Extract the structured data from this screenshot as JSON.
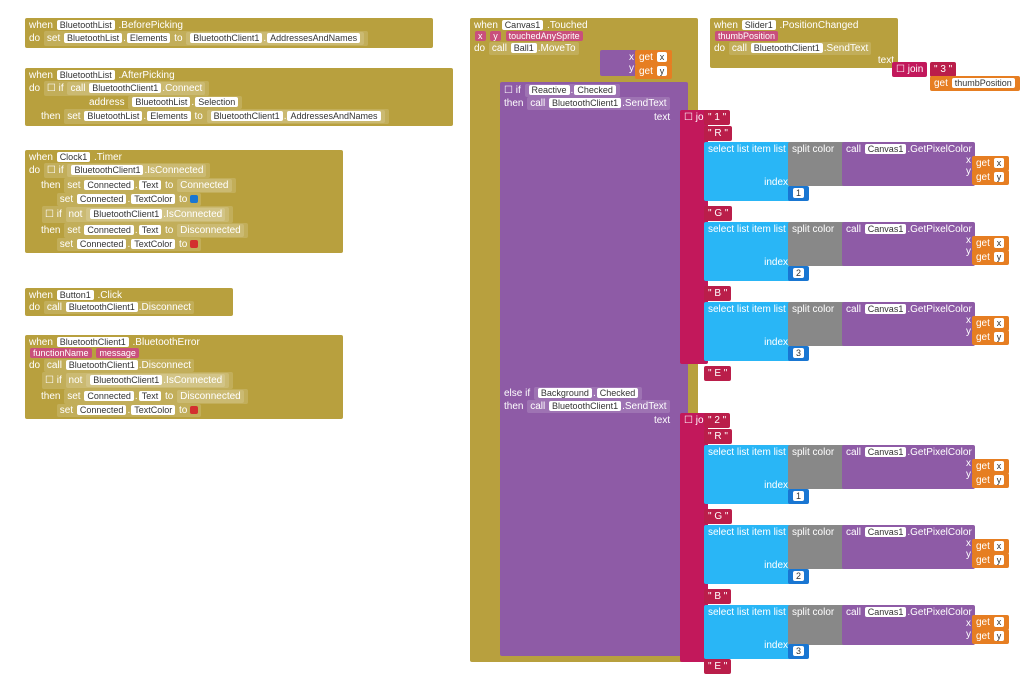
{
  "kw": {
    "when": "when",
    "do": "do",
    "set": "set",
    "call": "call",
    "if": "if",
    "then": "then",
    "elseif": "else if",
    "not": "not",
    "to": "to",
    "get": "get",
    "join": "join",
    "text": "text",
    "address": "address",
    "index": "index",
    "list": "list",
    "x": "x",
    "y": "y"
  },
  "comp": {
    "btlist": "BluetoothList",
    "btclient": "BluetoothClient1",
    "clock": "Clock1",
    "button": "Button1",
    "connected": "Connected",
    "canvas": "Canvas1",
    "ball": "Ball1",
    "slider": "Slider1",
    "reactive": "Reactive",
    "background": "Background"
  },
  "evt": {
    "beforepicking": "BeforePicking",
    "afterpicking": "AfterPicking",
    "timer": "Timer",
    "click": "Click",
    "bterror": "BluetoothError",
    "touched": "Touched",
    "poschanged": "PositionChanged"
  },
  "meth": {
    "connect": "Connect",
    "disconnect": "Disconnect",
    "isconnected": "IsConnected",
    "sendtext": "SendText",
    "moveto": "MoveTo",
    "getpixel": "GetPixelColor",
    "splitcolor": "split color",
    "selectitem": "select list item"
  },
  "prop": {
    "elements": "Elements",
    "addrnames": "AddressesAndNames",
    "selection": "Selection",
    "textprop": "Text",
    "textcolor": "TextColor",
    "checked": "Checked"
  },
  "val": {
    "connected": "Connected",
    "disconnected": "Disconnected",
    "fname": "functionName",
    "message": "message",
    "touchedany": "touchedAnySprite",
    "thumbpos": "thumbPosition"
  },
  "str": {
    "s1": "\" 1 \"",
    "s2": "\" 2 \"",
    "s3": "\" 3 \"",
    "sR": "\" R \"",
    "sG": "\" G \"",
    "sB": "\" B \"",
    "sE": "\" E \""
  },
  "num": {
    "n1": "1",
    "n2": "2",
    "n3": "3"
  }
}
